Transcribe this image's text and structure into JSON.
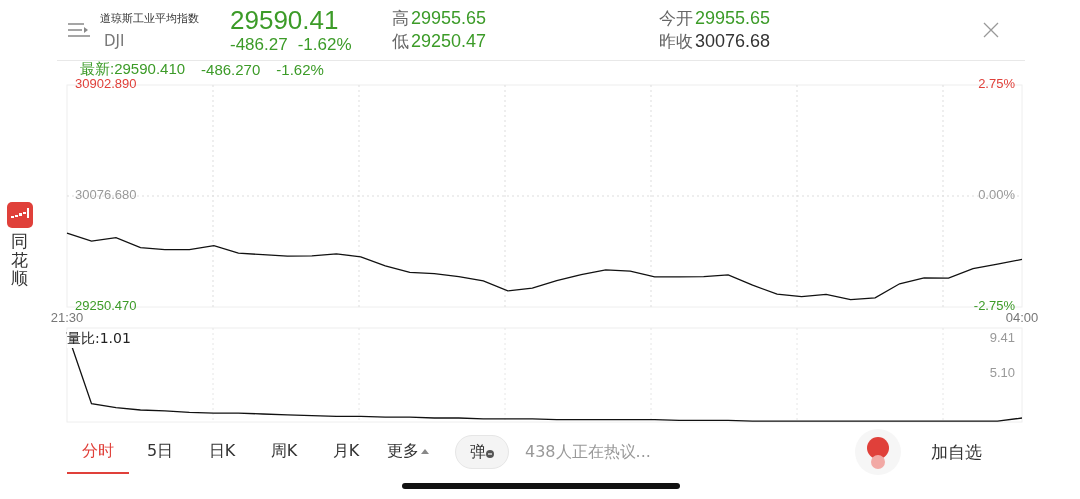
{
  "side_app": {
    "name": "同花顺"
  },
  "header": {
    "name": "道琼斯工业平均指数",
    "code": "DJI",
    "price": "29590.41",
    "change": "-486.27",
    "change_pct": "-1.62%",
    "stats": [
      {
        "label": "高",
        "value": "29955.65",
        "color": "#3c9b28"
      },
      {
        "label": "低",
        "value": "29250.47",
        "color": "#3c9b28"
      },
      {
        "label": "今开",
        "value": "29955.65",
        "color": "#3c9b28"
      },
      {
        "label": "昨收",
        "value": "30076.68",
        "color": "#333333"
      }
    ]
  },
  "latest": {
    "label": "最新:29590.410",
    "change": "-486.270",
    "pct": "-1.62%"
  },
  "price_chart": {
    "right_labels": [
      {
        "text": "2.75%",
        "color": "#e0403a"
      },
      {
        "text": "0.00%",
        "color": "#999999"
      },
      {
        "text": "-2.75%",
        "color": "#3c9b28"
      }
    ],
    "chart_data": {
      "type": "line",
      "grid": true,
      "ylim": [
        29250.47,
        30902.89
      ],
      "categories": [
        "21:30",
        null,
        null,
        null,
        null,
        null,
        null,
        null,
        null,
        null,
        null,
        null,
        null,
        null,
        null,
        null,
        null,
        null,
        null,
        null,
        null,
        null,
        null,
        null,
        null,
        null,
        null,
        null,
        null,
        null,
        null,
        null,
        null,
        null,
        null,
        null,
        null,
        null,
        null,
        "04:00"
      ],
      "yticks": [
        {
          "value": 30902.89,
          "label": "30902.890"
        },
        {
          "value": 30076.68,
          "label": "30076.680"
        },
        {
          "value": 29250.47,
          "label": "29250.470"
        }
      ],
      "series": [
        {
          "color": "#111111",
          "values": [
            29800,
            29740,
            29766,
            29692,
            29677,
            29677,
            29707,
            29652,
            29640,
            29629,
            29631,
            29646,
            29624,
            29557,
            29508,
            29499,
            29476,
            29445,
            29370,
            29391,
            29446,
            29492,
            29527,
            29517,
            29475,
            29475,
            29476,
            29490,
            29413,
            29346,
            29327,
            29344,
            29305,
            29318,
            29423,
            29467,
            29465,
            29536,
            29569,
            29605
          ]
        }
      ]
    }
  },
  "volume_chart": {
    "label": "量比:1.01",
    "chart_data": {
      "type": "line",
      "grid": true,
      "ylim": [
        -1,
        10.6
      ],
      "categories": [
        null,
        null,
        null,
        null,
        null,
        null,
        null,
        null,
        null,
        null,
        null,
        null,
        null,
        null,
        null,
        null,
        null,
        null,
        null,
        null,
        null,
        null,
        null,
        null,
        null,
        null,
        null,
        null,
        null,
        null,
        null,
        null,
        null,
        null,
        null,
        null,
        null,
        null,
        null,
        null
      ],
      "yticks": [
        {
          "value": 9.41,
          "label": "9.41"
        },
        {
          "value": 5.1,
          "label": "5.10"
        }
      ],
      "series": [
        {
          "color": "#111111",
          "values": [
            10.2,
            1.3,
            0.8,
            0.5,
            0.4,
            0.2,
            0.1,
            0.1,
            0,
            -0.1,
            -0.2,
            -0.3,
            -0.3,
            -0.4,
            -0.4,
            -0.5,
            -0.5,
            -0.6,
            -0.6,
            -0.6,
            -0.7,
            -0.7,
            -0.7,
            -0.7,
            -0.7,
            -0.8,
            -0.8,
            -0.8,
            -0.9,
            -0.9,
            -0.9,
            -0.9,
            -0.9,
            -0.9,
            -0.9,
            -0.9,
            -0.9,
            -0.9,
            -0.9,
            -0.5
          ]
        }
      ]
    }
  },
  "tabs": [
    {
      "label": "分时",
      "selected": true,
      "kind": "tab"
    },
    {
      "label": "5日",
      "selected": false,
      "kind": "tab"
    },
    {
      "label": "日K",
      "selected": false,
      "kind": "tab"
    },
    {
      "label": "周K",
      "selected": false,
      "kind": "tab"
    },
    {
      "label": "月K",
      "selected": false,
      "kind": "tab"
    },
    {
      "label": "更多",
      "selected": false,
      "kind": "menu"
    }
  ],
  "danmaku": {
    "label": "弹",
    "discussion": "438人正在热议..."
  },
  "watch_button": "加自选"
}
